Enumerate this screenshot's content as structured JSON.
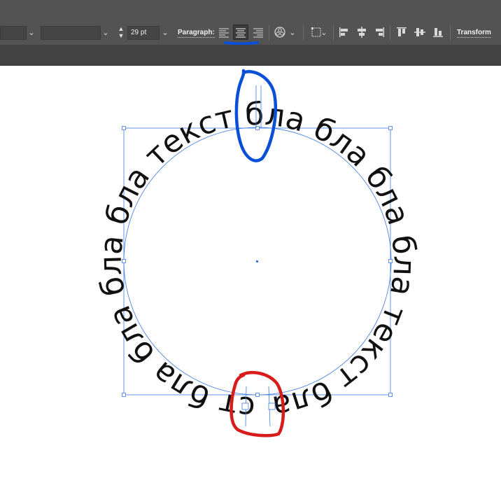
{
  "toolbar": {
    "font_size_value": "29 pt",
    "paragraph_label": "Paragraph:",
    "transform_label": "Transform"
  },
  "canvas": {
    "path_text": "бла текст бла бла бла бла текст бла бла бла бла текст бла бла бла",
    "accent_color": "#3c7be0",
    "blue_annotation_color": "#0a4fd8",
    "red_annotation_color": "#d81c1c"
  }
}
